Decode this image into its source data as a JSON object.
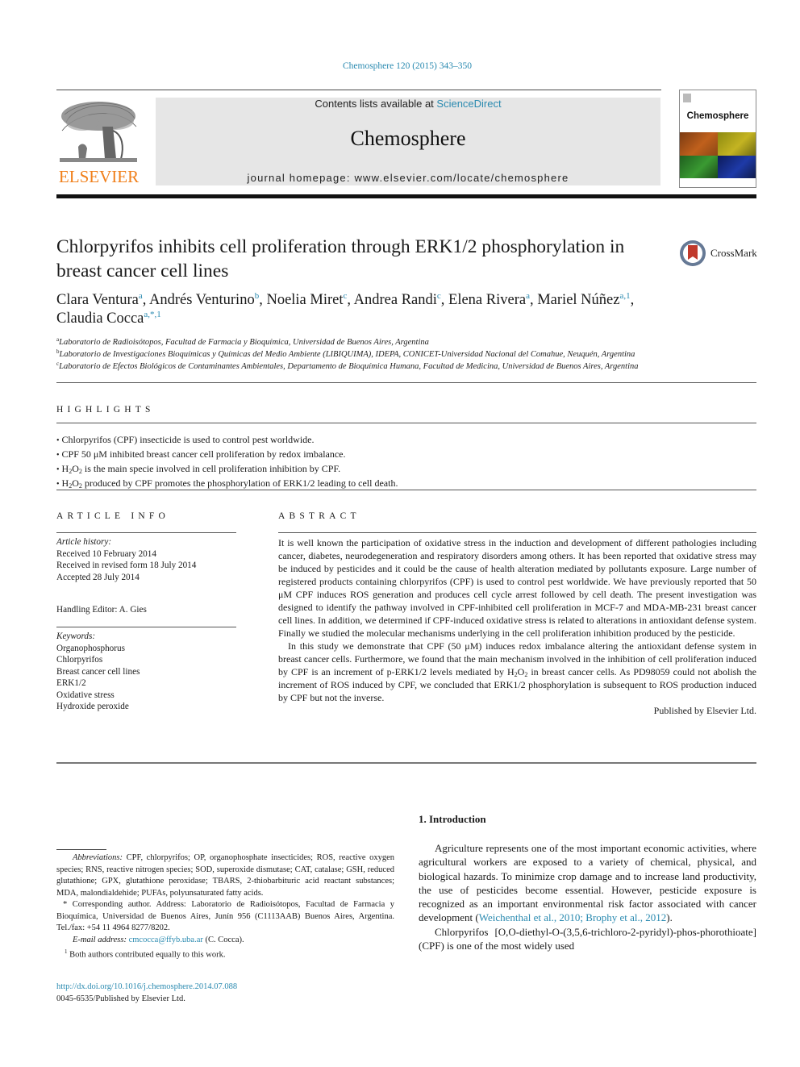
{
  "header": {
    "citation": "Chemosphere 120 (2015) 343–350",
    "contents_prefix": "Contents lists available at ",
    "contents_link": "ScienceDirect",
    "journal_name": "Chemosphere",
    "homepage": "journal homepage: www.elsevier.com/locate/chemosphere",
    "publisher_logo_text": "ELSEVIER",
    "cover_title": "Chemosphere",
    "colors": {
      "link": "#2a8ab0",
      "elsevier_orange": "#f07f1a"
    }
  },
  "article": {
    "title": "Chlorpyrifos inhibits cell proliferation through ERK1/2 phosphorylation in breast cancer cell lines",
    "crossmark_label": "CrossMark",
    "authors": [
      {
        "name": "Clara Ventura",
        "sup": "a",
        "sep": ", "
      },
      {
        "name": "Andrés Venturino",
        "sup": "b",
        "sep": ", "
      },
      {
        "name": "Noelia Miret",
        "sup": "c",
        "sep": ", "
      },
      {
        "name": "Andrea Randi",
        "sup": "c",
        "sep": ", "
      },
      {
        "name": "Elena Rivera",
        "sup": "a",
        "sep": ", "
      },
      {
        "name": "Mariel Núñez",
        "sup": "a,1",
        "sep": ","
      },
      {
        "name": "Claudia Cocca",
        "sup": "a,*,1",
        "sep": ""
      }
    ],
    "affiliations": [
      {
        "key": "a",
        "text": "Laboratorio de Radioisótopos, Facultad de Farmacia y Bioquímica, Universidad de Buenos Aires, Argentina"
      },
      {
        "key": "b",
        "text": "Laboratorio de Investigaciones Bioquímicas y Químicas del Medio Ambiente (LIBIQUIMA), IDEPA, CONICET-Universidad Nacional del Comahue, Neuquén, Argentina"
      },
      {
        "key": "c",
        "text": "Laboratorio de Efectos Biológicos de Contaminantes Ambientales, Departamento de Bioquímica Humana, Facultad de Medicina, Universidad de Buenos Aires, Argentina"
      }
    ]
  },
  "highlights": {
    "heading": "HIGHLIGHTS",
    "items": [
      {
        "pre": "Chlorpyrifos (CPF) insecticide is used to control pest worldwide.",
        "h2o2": false,
        "post": ""
      },
      {
        "pre": "CPF 50 μM inhibited breast cancer cell proliferation by redox imbalance.",
        "h2o2": false,
        "post": ""
      },
      {
        "pre": "",
        "h2o2": true,
        "post": " is the main specie involved in cell proliferation inhibition by CPF."
      },
      {
        "pre": "",
        "h2o2": true,
        "post": " produced by CPF promotes the phosphorylation of ERK1/2 leading to cell death."
      }
    ]
  },
  "article_info": {
    "heading": "ARTICLE INFO",
    "history_label": "Article history:",
    "history": [
      "Received 10 February 2014",
      "Received in revised form 18 July 2014",
      "Accepted 28 July 2014"
    ],
    "handling_editor": "Handling Editor: A. Gies",
    "keywords_label": "Keywords:",
    "keywords": [
      "Organophosphorus",
      "Chlorpyrifos",
      "Breast cancer cell lines",
      "ERK1/2",
      "Oxidative stress",
      "Hydroxide peroxide"
    ]
  },
  "abstract": {
    "heading": "ABSTRACT",
    "p1": "It is well known the participation of oxidative stress in the induction and development of different pathologies including cancer, diabetes, neurodegeneration and respiratory disorders among others. It has been reported that oxidative stress may be induced by pesticides and it could be the cause of health alteration mediated by pollutants exposure. Large number of registered products containing chlorpyrifos (CPF) is used to control pest worldwide. We have previously reported that 50 μM CPF induces ROS generation and produces cell cycle arrest followed by cell death. The present investigation was designed to identify the pathway involved in CPF-inhibited cell proliferation in MCF-7 and MDA-MB-231 breast cancer cell lines. In addition, we determined if CPF-induced oxidative stress is related to alterations in antioxidant defense system. Finally we studied the molecular mechanisms underlying in the cell proliferation inhibition produced by the pesticide.",
    "p2_before": "In this study we demonstrate that CPF (50 μM) induces redox imbalance altering the antioxidant defense system in breast cancer cells. Furthermore, we found that the main mechanism involved in the inhibition of cell proliferation induced by CPF is an increment of p-ERK1/2 levels mediated by ",
    "p2_after": " in breast cancer cells. As PD98059 could not abolish the increment of ROS induced by CPF, we concluded that ERK1/2 phosphorylation is subsequent to ROS production induced by CPF but not the inverse.",
    "publisher": "Published by Elsevier Ltd."
  },
  "chem": {
    "h": "H",
    "two": "2",
    "o": "O"
  },
  "footnotes": {
    "abbrev_label": "Abbreviations:",
    "abbrev_text": " CPF, chlorpyrifos; OP, organophosphate insecticides; ROS, reactive oxygen species; RNS, reactive nitrogen species; SOD, superoxide dismutase; CAT, catalase; GSH, reduced glutathione; GPX, glutathione peroxidase; TBARS, 2-thiobarbituric acid reactant substances; MDA, malondialdehide; PUFAs, polyunsaturated fatty acids.",
    "corresponding": "* Corresponding author. Address: Laboratorio de Radioisótopos, Facultad de Farmacia y Bioquímica, Universidad de Buenos Aires, Junín 956 (C1113AAB) Buenos Aires, Argentina. Tel./fax: +54 11 4964 8277/8202.",
    "email_label": "E-mail address:",
    "email": "cmcocca@ffyb.uba.ar",
    "email_suffix": " (C. Cocca).",
    "equal_sup": "1",
    "equal_text": " Both authors contributed equally to this work.",
    "doi": "http://dx.doi.org/10.1016/j.chemosphere.2014.07.088",
    "issn": "0045-6535/Published by Elsevier Ltd."
  },
  "introduction": {
    "heading": "1. Introduction",
    "p1_before": "Agriculture represents one of the most important economic activities, where agricultural workers are exposed to a variety of chemical, physical, and biological hazards. To minimize crop damage and to increase land productivity, the use of pesticides become essential. However, pesticide exposure is recognized as an important environmental risk factor associated with cancer development (",
    "ref1": "Weichenthal et al., 2010",
    "ref_sep": "; ",
    "ref2": "Brophy et al., 2012",
    "p1_after": ").",
    "p2": "Chlorpyrifos [O,O-diethyl-O-(3,5,6-trichloro-2-pyridyl)-phos-phorothioate] (CPF) is one of the most widely used"
  }
}
